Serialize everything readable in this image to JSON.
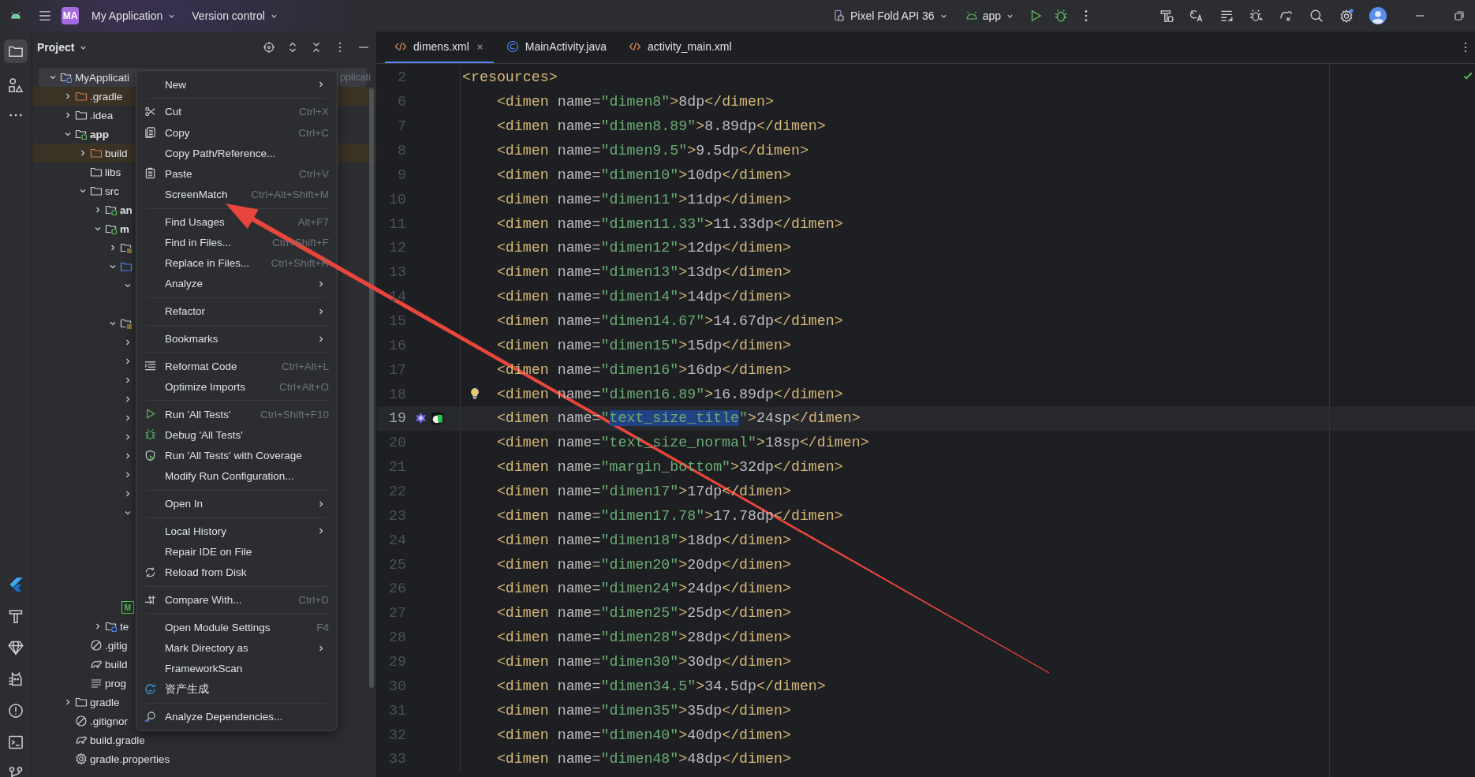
{
  "title_bar": {
    "project_badge": "MA",
    "project": "My Application",
    "vcs": "Version control",
    "device": "Pixel Fold API 36",
    "run_config": "app"
  },
  "project_panel": {
    "title": "Project"
  },
  "tree": [
    {
      "label": "MyApplicati",
      "hint": "pplicati",
      "kind": "project",
      "expanded": true,
      "selected": true,
      "children": [
        {
          "label": ".gradle",
          "kind": "excluded",
          "expanded": false,
          "selected": false
        },
        {
          "label": ".idea",
          "kind": "folder",
          "expanded": false,
          "selected": false
        },
        {
          "label": "app",
          "kind": "module",
          "expanded": true,
          "selected": false,
          "children": [
            {
              "label": "build",
              "kind": "excluded",
              "expanded": false,
              "selected": false
            },
            {
              "label": "libs",
              "kind": "folder",
              "selected": false
            },
            {
              "label": "src",
              "kind": "folder",
              "expanded": true,
              "selected": false,
              "children": [
                {
                  "label": "an",
                  "kind": "module",
                  "expanded": false,
                  "selected": false
                },
                {
                  "label": "m",
                  "kind": "module",
                  "expanded": true,
                  "selected": false,
                  "children": [
                    {
                      "kind": "res",
                      "expanded": false,
                      "selected": false
                    },
                    {
                      "kind": "source",
                      "expanded": true,
                      "selected": false,
                      "children": [
                        {
                          "expanded": true,
                          "selected": false,
                          "children": [
                            {
                              "selected": false
                            }
                          ]
                        }
                      ]
                    },
                    {
                      "kind": "res",
                      "expanded": true,
                      "selected": false,
                      "children": [
                        {
                          "expanded": false,
                          "selected": false
                        },
                        {
                          "expanded": false,
                          "selected": false
                        },
                        {
                          "expanded": false,
                          "selected": false
                        },
                        {
                          "expanded": false,
                          "selected": false
                        },
                        {
                          "expanded": false,
                          "selected": false
                        },
                        {
                          "expanded": false,
                          "selected": false
                        },
                        {
                          "expanded": false,
                          "selected": false
                        },
                        {
                          "expanded": false,
                          "selected": false
                        },
                        {
                          "expanded": false,
                          "selected": false
                        },
                        {
                          "expanded": true,
                          "selected": false,
                          "children": [
                            {
                              "selected": false
                            },
                            {
                              "selected": false
                            },
                            {
                              "selected": false
                            },
                            {
                              "selected": false
                            }
                          ]
                        }
                      ]
                    },
                    {
                      "kind": "manifest",
                      "badge": "M",
                      "selected": false
                    }
                  ]
                },
                {
                  "label": "te",
                  "kind": "test",
                  "expanded": false,
                  "selected": false
                }
              ]
            },
            {
              "label": ".gitig",
              "kind": "gitignore",
              "selected": false
            },
            {
              "label": "build",
              "kind": "gradle",
              "selected": false
            },
            {
              "label": "prog",
              "kind": "text",
              "selected": false
            }
          ]
        },
        {
          "label": "gradle",
          "kind": "folder",
          "expanded": false,
          "selected": false
        },
        {
          "label": ".gitignor",
          "kind": "gitignore",
          "selected": false
        },
        {
          "label": "build.gradle",
          "kind": "gradle",
          "selected": false
        },
        {
          "label": "gradle.properties",
          "kind": "properties",
          "selected": false
        }
      ]
    }
  ],
  "tabs": [
    {
      "label": "dimens.xml",
      "kind": "xml",
      "selected": true,
      "closable": true
    },
    {
      "label": "MainActivity.java",
      "kind": "java",
      "selected": false,
      "closable": false
    },
    {
      "label": "activity_main.xml",
      "kind": "xml",
      "selected": false,
      "closable": false
    }
  ],
  "lines": [
    {
      "number": "2",
      "text": "<resources>",
      "current": false
    },
    {
      "number": "6",
      "text": "    <dimen name=\"dimen8\">8dp</dimen>",
      "current": false
    },
    {
      "number": "7",
      "text": "    <dimen name=\"dimen8.89\">8.89dp</dimen>",
      "current": false
    },
    {
      "number": "8",
      "text": "    <dimen name=\"dimen9.5\">9.5dp</dimen>",
      "current": false
    },
    {
      "number": "9",
      "text": "    <dimen name=\"dimen10\">10dp</dimen>",
      "current": false
    },
    {
      "number": "10",
      "text": "    <dimen name=\"dimen11\">11dp</dimen>",
      "current": false
    },
    {
      "number": "11",
      "text": "    <dimen name=\"dimen11.33\">11.33dp</dimen>",
      "current": false
    },
    {
      "number": "12",
      "text": "    <dimen name=\"dimen12\">12dp</dimen>",
      "current": false
    },
    {
      "number": "13",
      "text": "    <dimen name=\"dimen13\">13dp</dimen>",
      "current": false
    },
    {
      "number": "14",
      "text": "    <dimen name=\"dimen14\">14dp</dimen>",
      "current": false
    },
    {
      "number": "15",
      "text": "    <dimen name=\"dimen14.67\">14.67dp</dimen>",
      "current": false
    },
    {
      "number": "16",
      "text": "    <dimen name=\"dimen15\">15dp</dimen>",
      "current": false
    },
    {
      "number": "17",
      "text": "    <dimen name=\"dimen16\">16dp</dimen>",
      "current": false
    },
    {
      "number": "18",
      "text": "    <dimen name=\"dimen16.89\">16.89dp</dimen>",
      "current": false,
      "bulb": true
    },
    {
      "number": "19",
      "text": "    <dimen name=\"",
      "selection": "text_size_title",
      "text_after": "\">24sp</dimen>",
      "current": true,
      "gutter_marks": true
    },
    {
      "number": "20",
      "text": "    <dimen name=\"text_size_normal\">18sp</dimen>",
      "current": false
    },
    {
      "number": "21",
      "text": "    <dimen name=\"margin_bottom\">32dp</dimen>",
      "current": false
    },
    {
      "number": "22",
      "text": "    <dimen name=\"dimen17\">17dp</dimen>",
      "current": false
    },
    {
      "number": "23",
      "text": "    <dimen name=\"dimen17.78\">17.78dp</dimen>",
      "current": false
    },
    {
      "number": "24",
      "text": "    <dimen name=\"dimen18\">18dp</dimen>",
      "current": false
    },
    {
      "number": "25",
      "text": "    <dimen name=\"dimen20\">20dp</dimen>",
      "current": false
    },
    {
      "number": "26",
      "text": "    <dimen name=\"dimen24\">24dp</dimen>",
      "current": false
    },
    {
      "number": "27",
      "text": "    <dimen name=\"dimen25\">25dp</dimen>",
      "current": false
    },
    {
      "number": "28",
      "text": "    <dimen name=\"dimen28\">28dp</dimen>",
      "current": false
    },
    {
      "number": "29",
      "text": "    <dimen name=\"dimen30\">30dp</dimen>",
      "current": false
    },
    {
      "number": "30",
      "text": "    <dimen name=\"dimen34.5\">34.5dp</dimen>",
      "current": false
    },
    {
      "number": "31",
      "text": "    <dimen name=\"dimen35\">35dp</dimen>",
      "current": false
    },
    {
      "number": "32",
      "text": "    <dimen name=\"dimen40\">40dp</dimen>",
      "current": false
    },
    {
      "number": "33",
      "text": "    <dimen name=\"dimen48\">48dp</dimen>",
      "current": false
    }
  ],
  "context_menu": [
    {
      "kind": "plain",
      "label": "New",
      "submenu": true
    },
    {
      "kind": "separator"
    },
    {
      "kind": "cut",
      "label": "Cut",
      "shortcut": "Ctrl+X"
    },
    {
      "kind": "copy",
      "label": "Copy",
      "shortcut": "Ctrl+C"
    },
    {
      "kind": "plain",
      "label": "Copy Path/Reference..."
    },
    {
      "kind": "paste",
      "label": "Paste",
      "shortcut": "Ctrl+V"
    },
    {
      "kind": "plain",
      "label": "ScreenMatch",
      "shortcut": "Ctrl+Alt+Shift+M"
    },
    {
      "kind": "separator"
    },
    {
      "kind": "plain",
      "label": "Find Usages",
      "shortcut": "Alt+F7"
    },
    {
      "kind": "plain",
      "label": "Find in Files...",
      "shortcut": "Ctrl+Shift+F"
    },
    {
      "kind": "plain",
      "label": "Replace in Files...",
      "shortcut": "Ctrl+Shift+R"
    },
    {
      "kind": "plain",
      "label": "Analyze",
      "submenu": true
    },
    {
      "kind": "separator"
    },
    {
      "kind": "plain",
      "label": "Refactor",
      "submenu": true
    },
    {
      "kind": "separator"
    },
    {
      "kind": "plain",
      "label": "Bookmarks",
      "submenu": true
    },
    {
      "kind": "separator"
    },
    {
      "kind": "format",
      "label": "Reformat Code",
      "shortcut": "Ctrl+Alt+L"
    },
    {
      "kind": "plain",
      "label": "Optimize Imports",
      "shortcut": "Ctrl+Alt+O"
    },
    {
      "kind": "separator"
    },
    {
      "kind": "run",
      "label": "Run 'All Tests'",
      "shortcut": "Ctrl+Shift+F10"
    },
    {
      "kind": "debug",
      "label": "Debug 'All Tests'"
    },
    {
      "kind": "coverage",
      "label": "Run 'All Tests' with Coverage"
    },
    {
      "kind": "plain",
      "label": "Modify Run Configuration..."
    },
    {
      "kind": "separator"
    },
    {
      "kind": "plain",
      "label": "Open In",
      "submenu": true
    },
    {
      "kind": "separator"
    },
    {
      "kind": "plain",
      "label": "Local History",
      "submenu": true
    },
    {
      "kind": "plain",
      "label": "Repair IDE on File"
    },
    {
      "kind": "reload",
      "label": "Reload from Disk"
    },
    {
      "kind": "separator"
    },
    {
      "kind": "compare",
      "label": "Compare With...",
      "shortcut": "Ctrl+D"
    },
    {
      "kind": "separator"
    },
    {
      "kind": "plain",
      "label": "Open Module Settings",
      "shortcut": "F4"
    },
    {
      "kind": "plain",
      "label": "Mark Directory as",
      "submenu": true
    },
    {
      "kind": "plain",
      "label": "FrameworkScan"
    },
    {
      "kind": "asset",
      "label": "资产生成"
    },
    {
      "kind": "separator"
    },
    {
      "kind": "analyze",
      "label": "Analyze Dependencies..."
    }
  ]
}
